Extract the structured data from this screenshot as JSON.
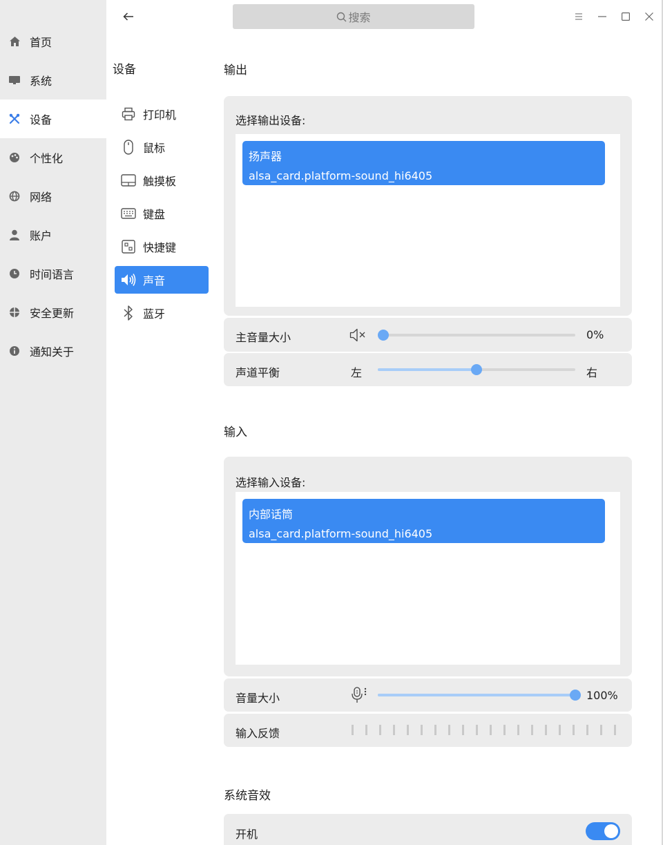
{
  "sidebar": {
    "items": [
      {
        "label": "首页",
        "icon": "home-icon"
      },
      {
        "label": "系统",
        "icon": "monitor-icon"
      },
      {
        "label": "设备",
        "icon": "tools-icon",
        "active": true
      },
      {
        "label": "个性化",
        "icon": "palette-icon"
      },
      {
        "label": "网络",
        "icon": "globe-icon"
      },
      {
        "label": "账户",
        "icon": "user-icon"
      },
      {
        "label": "时间语言",
        "icon": "clock-icon"
      },
      {
        "label": "安全更新",
        "icon": "shield-icon"
      },
      {
        "label": "通知关于",
        "icon": "info-icon"
      }
    ]
  },
  "titlebar": {
    "search_placeholder": "搜索",
    "buttons": [
      "menu-icon",
      "minimize-icon",
      "maximize-icon",
      "close-icon"
    ]
  },
  "subnav": {
    "title": "设备",
    "items": [
      {
        "label": "打印机",
        "icon": "printer-icon"
      },
      {
        "label": "鼠标",
        "icon": "mouse-icon"
      },
      {
        "label": "触摸板",
        "icon": "touchpad-icon"
      },
      {
        "label": "键盘",
        "icon": "keyboard-icon"
      },
      {
        "label": "快捷键",
        "icon": "shortcut-icon"
      },
      {
        "label": "声音",
        "icon": "speaker-icon",
        "active": true
      },
      {
        "label": "蓝牙",
        "icon": "bluetooth-icon"
      }
    ]
  },
  "output": {
    "title": "输出",
    "select_label": "选择输出设备:",
    "device": {
      "name": "扬声器",
      "id": "alsa_card.platform-sound_hi6405"
    },
    "volume": {
      "label": "主音量大小",
      "value": 0,
      "value_text": "0%",
      "icon": "muted-speaker-icon"
    },
    "balance": {
      "label": "声道平衡",
      "left": "左",
      "right": "右",
      "value": 0.5
    }
  },
  "input": {
    "title": "输入",
    "select_label": "选择输入设备:",
    "device": {
      "name": "内部话筒",
      "id": "alsa_card.platform-sound_hi6405"
    },
    "volume": {
      "label": "音量大小",
      "value": 1.0,
      "value_text": "100%",
      "icon": "microphone-icon"
    },
    "feedback": {
      "label": "输入反馈",
      "level": 0
    }
  },
  "effects": {
    "title": "系统音效",
    "items": [
      {
        "label": "开机",
        "enabled": true
      }
    ]
  },
  "colors": {
    "accent": "#3a8af2",
    "sidebar_bg": "#ebebeb",
    "panel_bg": "#ececec"
  }
}
